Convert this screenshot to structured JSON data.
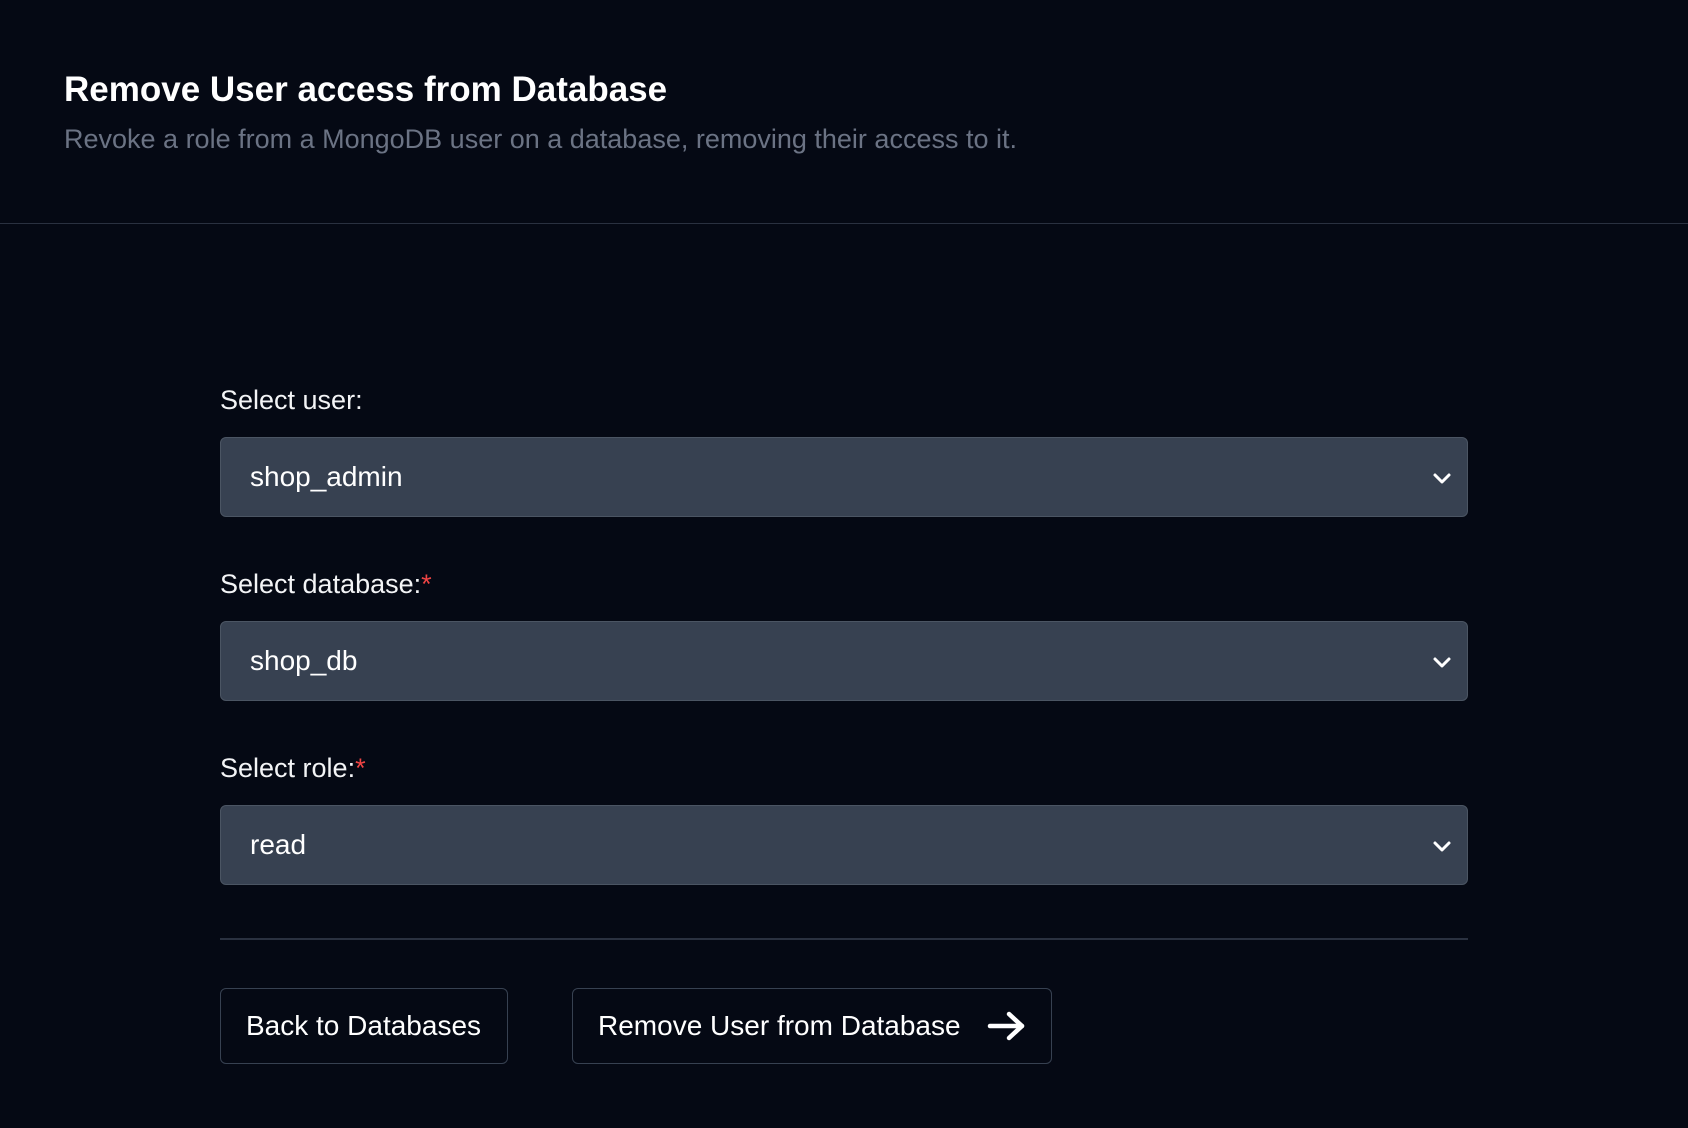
{
  "header": {
    "title": "Remove User access from Database",
    "subtitle": "Revoke a role from a MongoDB user on a database, removing their access to it."
  },
  "form": {
    "user": {
      "label": "Select user:",
      "required": false,
      "selected": "shop_admin",
      "icon": "chevron-down-icon"
    },
    "database": {
      "label": "Select database:",
      "required": true,
      "required_mark": "*",
      "selected": "shop_db",
      "icon": "chevron-down-icon"
    },
    "role": {
      "label": "Select role:",
      "required": true,
      "required_mark": "*",
      "selected": "read",
      "icon": "chevron-down-icon"
    }
  },
  "actions": {
    "back_label": "Back to Databases",
    "submit_label": "Remove User from Database",
    "submit_icon": "arrow-right-icon"
  },
  "colors": {
    "background": "#050914",
    "select_background": "#374151",
    "required": "#ef4444",
    "subtitle": "#6b7384"
  }
}
